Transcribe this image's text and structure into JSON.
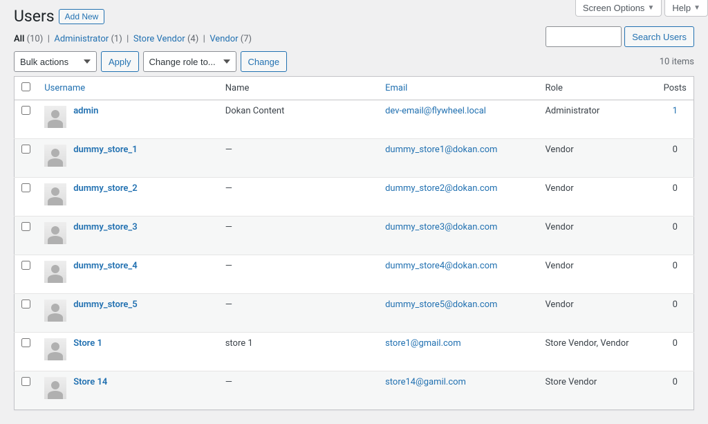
{
  "topButtons": {
    "screenOptions": "Screen Options",
    "help": "Help"
  },
  "page": {
    "title": "Users",
    "addNew": "Add New"
  },
  "filters": {
    "all": {
      "label": "All",
      "count": "(10)"
    },
    "admin": {
      "label": "Administrator",
      "count": "(1)"
    },
    "storeVendor": {
      "label": "Store Vendor",
      "count": "(4)"
    },
    "vendor": {
      "label": "Vendor",
      "count": "(7)"
    }
  },
  "actions": {
    "bulk": "Bulk actions",
    "apply": "Apply",
    "changeRole": "Change role to...",
    "change": "Change",
    "searchBtn": "Search Users"
  },
  "summary": {
    "itemsCount": "10 items"
  },
  "columns": {
    "username": "Username",
    "name": "Name",
    "email": "Email",
    "role": "Role",
    "posts": "Posts"
  },
  "rows": [
    {
      "username": "admin",
      "name": "Dokan Content",
      "email": "dev-email@flywheel.local",
      "role": "Administrator",
      "posts": "1",
      "postsLink": true
    },
    {
      "username": "dummy_store_1",
      "name": "—",
      "email": "dummy_store1@dokan.com",
      "role": "Vendor",
      "posts": "0"
    },
    {
      "username": "dummy_store_2",
      "name": "—",
      "email": "dummy_store2@dokan.com",
      "role": "Vendor",
      "posts": "0"
    },
    {
      "username": "dummy_store_3",
      "name": "—",
      "email": "dummy_store3@dokan.com",
      "role": "Vendor",
      "posts": "0"
    },
    {
      "username": "dummy_store_4",
      "name": "—",
      "email": "dummy_store4@dokan.com",
      "role": "Vendor",
      "posts": "0"
    },
    {
      "username": "dummy_store_5",
      "name": "—",
      "email": "dummy_store5@dokan.com",
      "role": "Vendor",
      "posts": "0"
    },
    {
      "username": "Store 1",
      "name": "store 1",
      "email": "store1@gmail.com",
      "role": "Store Vendor, Vendor",
      "posts": "0"
    },
    {
      "username": "Store 14",
      "name": "—",
      "email": "store14@gamil.com",
      "role": "Store Vendor",
      "posts": "0"
    }
  ]
}
